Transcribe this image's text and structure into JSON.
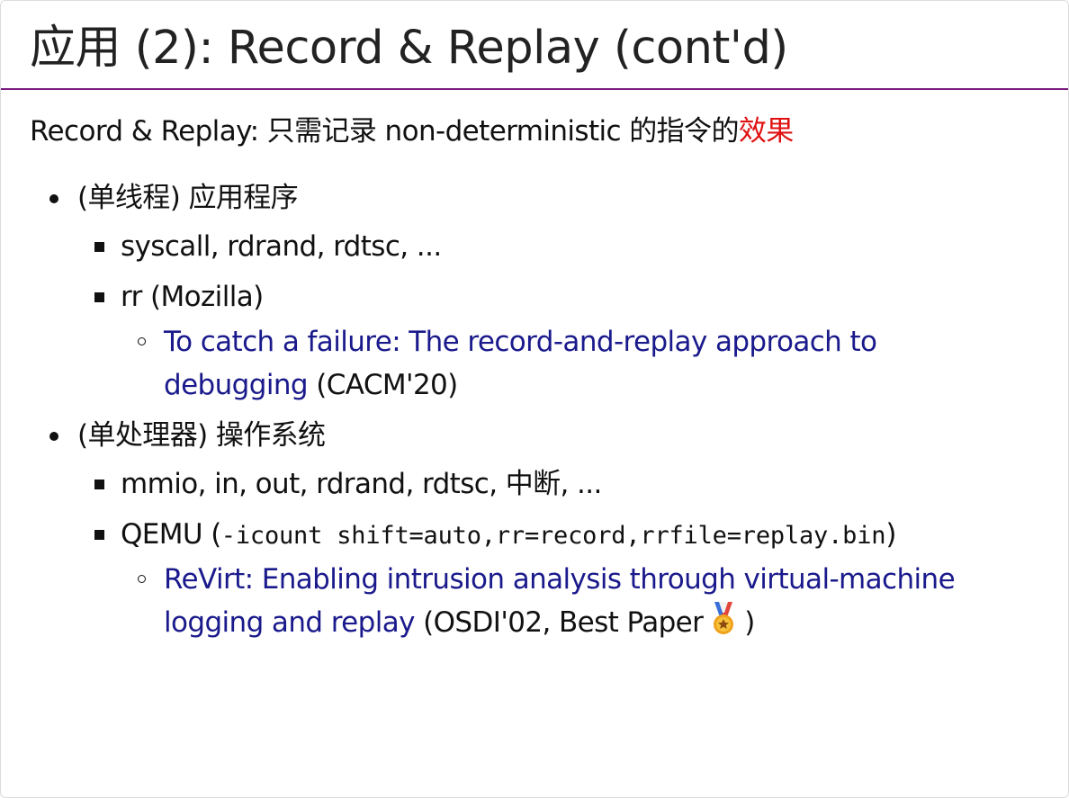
{
  "title": "应用 (2): Record & Replay (cont'd)",
  "intro": {
    "prefix": "Record & Replay: 只需记录 non-deterministic 的指令的",
    "highlight": "效果"
  },
  "colors": {
    "rule": "#7a1a7e",
    "highlight": "#e01010",
    "link": "#1a1a8c"
  },
  "items": [
    {
      "label": "(单线程) 应用程序",
      "sub": [
        {
          "label": "syscall, rdrand, rdtsc, ..."
        },
        {
          "label": "rr (Mozilla)",
          "ref": {
            "link": "To catch a failure: The record-and-replay approach to debugging",
            "suffix": " (CACM'20)"
          }
        }
      ]
    },
    {
      "label": "(单处理器) 操作系统",
      "sub": [
        {
          "label": "mmio, in, out, rdrand, rdtsc, 中断, ..."
        },
        {
          "label": "QEMU (",
          "code": "-icount shift=auto,rr=record,rrfile=replay.bin",
          "close": ")",
          "ref": {
            "link": "ReVirt: Enabling intrusion analysis through virtual-machine logging and replay",
            "suffix_pre": " (OSDI'02, Best Paper",
            "icon": "medal-icon",
            "suffix_post": ")"
          }
        }
      ]
    }
  ]
}
